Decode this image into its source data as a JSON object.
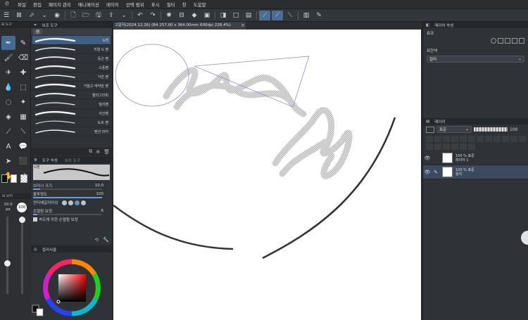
{
  "menu": {
    "logo": "ᘓ",
    "items": [
      "파일",
      "편집",
      "페이지 관리",
      "애니메이션",
      "레이어",
      "선택 범위",
      "표시",
      "필터",
      "창",
      "도움말"
    ]
  },
  "document": {
    "tab_label": "2일자(2024.12.26) (B4 257.00 x 364.00mm 600dpi 228.4%)"
  },
  "toolbox": {
    "size_value": "10.0",
    "size_unit": "px",
    "opacity_value": "100",
    "opacity_unit": "%"
  },
  "subtool": {
    "panel_tab": "보조 도구",
    "group_label": "펜",
    "brushes": [
      {
        "name": "G펜",
        "selected": true
      },
      {
        "name": "리얼 G 펜",
        "selected": false
      },
      {
        "name": "둥근 펜",
        "selected": false
      },
      {
        "name": "스푼펜",
        "selected": false
      },
      {
        "name": "거친 펜",
        "selected": false
      },
      {
        "name": "거칠고 약약한 펜",
        "selected": false
      },
      {
        "name": "캘리그라피",
        "selected": false
      },
      {
        "name": "밀리펜",
        "selected": false
      },
      {
        "name": "사인펜",
        "selected": false
      },
      {
        "name": "도트 펜",
        "selected": false
      },
      {
        "name": "펜션 마커",
        "selected": false
      }
    ]
  },
  "toolprop": {
    "panel_tab": "도구 속성",
    "panel_tab2": "보조 도구",
    "preview_name": "G펜",
    "brush_size_label": "브러시 크기",
    "brush_size_value": "10.0",
    "brush_size_fraction": 0.1,
    "opacity_label": "불투명도",
    "opacity_value": "100",
    "opacity_fraction": 1.0,
    "antialias_label": "안티에일리어싱",
    "stabilize_label": "손떨림 보정",
    "stabilize_value": "6",
    "stabilize_fraction": 0.06,
    "speed_label": "속도에 의한 손떨림 보정"
  },
  "color_panel": {
    "tab": "컬러서클"
  },
  "right": {
    "property_tab": "레이어 속성",
    "effect_label": "효과",
    "expression_label": "표현색",
    "expression_value": "컬러",
    "layer_tab": "레이어",
    "blend_mode": "표준",
    "layer_opacity": "100",
    "layers": [
      {
        "opacity": "100 % 표준",
        "name": "레이어 1",
        "selected": false
      },
      {
        "opacity": "100 % 표준",
        "name": "용지",
        "selected": true
      }
    ]
  },
  "colors": {
    "accent": "#466b92",
    "panel": "#2f3236",
    "selection": "#3f5f82"
  }
}
